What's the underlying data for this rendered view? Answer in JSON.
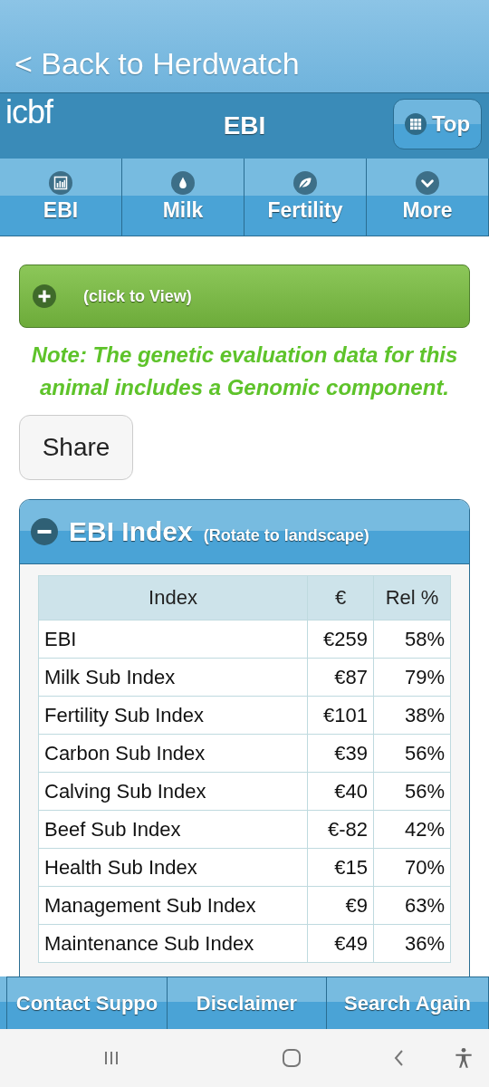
{
  "back_link": "< Back to Herdwatch",
  "header": {
    "logo": "icbf",
    "title": "EBI",
    "top_button": "Top"
  },
  "nav_tabs": [
    {
      "label": "EBI",
      "kind": "chart"
    },
    {
      "label": "Milk",
      "kind": "drop"
    },
    {
      "label": "Fertility",
      "kind": "leaf"
    },
    {
      "label": "More",
      "kind": "chevron"
    }
  ],
  "collapsible": {
    "label": "(click to View)",
    "expanded": false
  },
  "note": "Note: The genetic evaluation data for this animal includes a Genomic component.",
  "share_button": "Share",
  "card": {
    "title": "EBI Index",
    "subtitle": "(Rotate to landscape)",
    "expanded": true,
    "table": {
      "columns": [
        "Index",
        "€",
        "Rel %"
      ],
      "rows": [
        [
          "EBI",
          "€259",
          "58%"
        ],
        [
          "Milk Sub Index",
          "€87",
          "79%"
        ],
        [
          "Fertility Sub Index",
          "€101",
          "38%"
        ],
        [
          "Carbon Sub Index",
          "€39",
          "56%"
        ],
        [
          "Calving Sub Index",
          "€40",
          "56%"
        ],
        [
          "Beef Sub Index",
          "€-82",
          "42%"
        ],
        [
          "Health Sub Index",
          "€15",
          "70%"
        ],
        [
          "Management Sub Index",
          "€9",
          "63%"
        ],
        [
          "Maintenance Sub Index",
          "€49",
          "36%"
        ]
      ]
    }
  },
  "footer": [
    "Contact Suppo",
    "Disclaimer",
    "Search Again"
  ]
}
